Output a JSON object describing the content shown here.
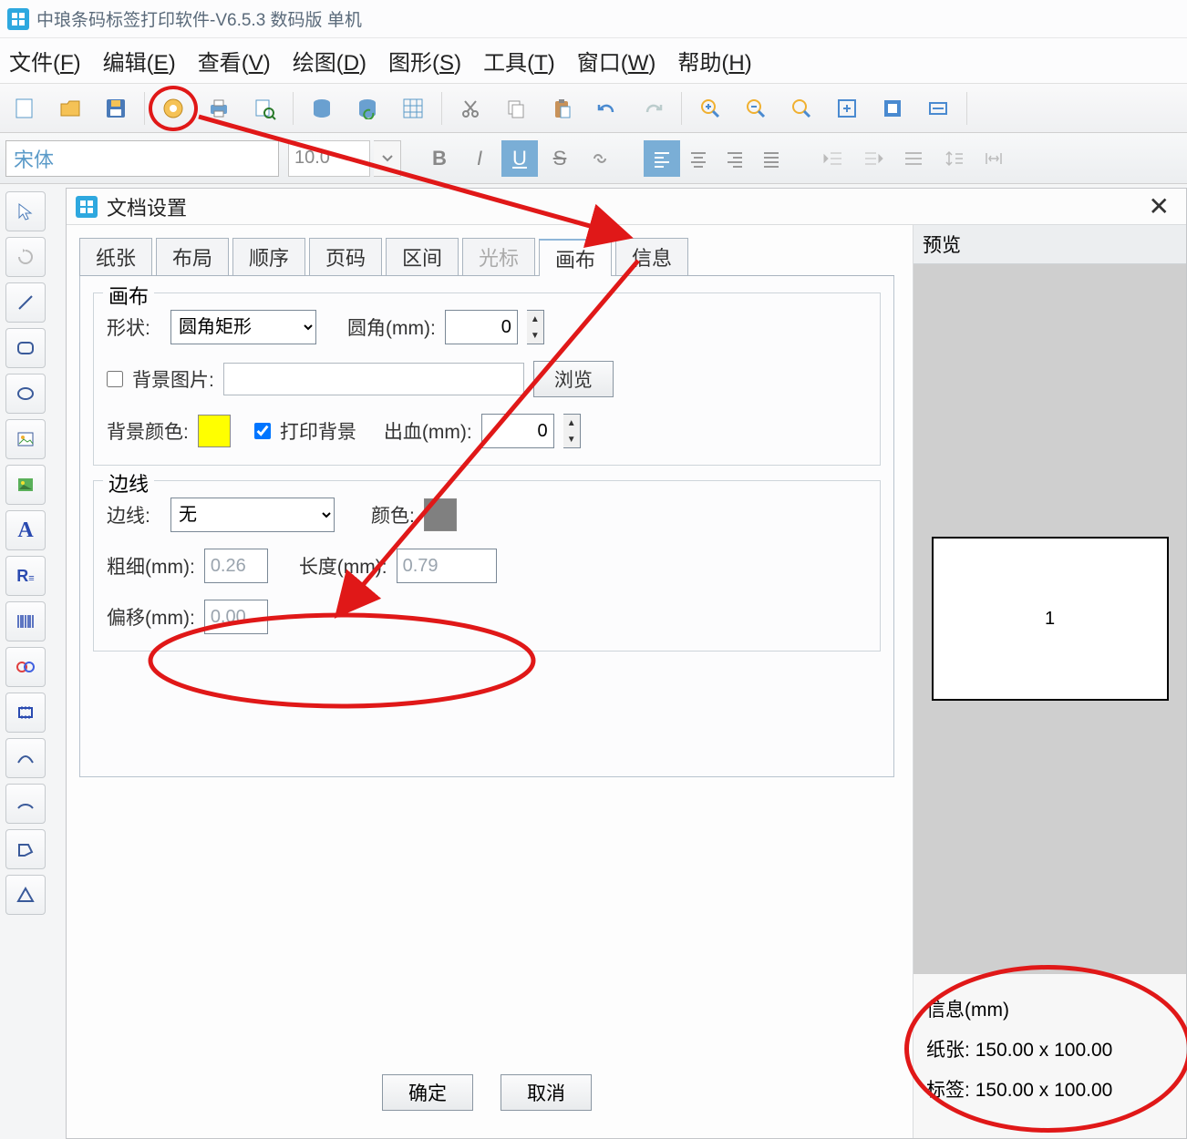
{
  "app": {
    "title": "中琅条码标签打印软件-V6.5.3 数码版 单机"
  },
  "menu": {
    "file": "文件",
    "file_k": "F",
    "edit": "编辑",
    "edit_k": "E",
    "view": "查看",
    "view_k": "V",
    "draw": "绘图",
    "draw_k": "D",
    "shape": "图形",
    "shape_k": "S",
    "tool": "工具",
    "tool_k": "T",
    "window": "窗口",
    "window_k": "W",
    "help": "帮助",
    "help_k": "H"
  },
  "font": {
    "family": "宋体",
    "size": "10.0"
  },
  "dialog": {
    "title": "文档设置",
    "tabs": {
      "paper": "纸张",
      "layout": "布局",
      "order": "顺序",
      "pagenum": "页码",
      "range": "区间",
      "cursor": "光标",
      "canvas": "画布",
      "info": "信息"
    },
    "canvas_group": "画布",
    "shape_label": "形状:",
    "shape_value": "圆角矩形",
    "corner_label": "圆角(mm):",
    "corner_value": "0",
    "bgimg_label": "背景图片:",
    "browse": "浏览",
    "bgcolor_label": "背景颜色:",
    "bgcolor_value": "#ffff00",
    "printbg_label": "打印背景",
    "bleed_label": "出血(mm):",
    "bleed_value": "0",
    "border_group": "边线",
    "border_label": "边线:",
    "border_value": "无",
    "color_label": "颜色:",
    "color_value": "#808080",
    "thickness_label": "粗细(mm):",
    "thickness_value": "0.26",
    "length_label": "长度(mm):",
    "length_value": "0.79",
    "offset_label": "偏移(mm):",
    "offset_value": "0.00",
    "ok": "确定",
    "cancel": "取消"
  },
  "preview": {
    "title": "预览",
    "page_number": "1",
    "info_title": "信息(mm)",
    "paper_label": "纸张:",
    "paper_value": "150.00 x 100.00",
    "label_label": "标签:",
    "label_value": "150.00 x 100.00"
  }
}
